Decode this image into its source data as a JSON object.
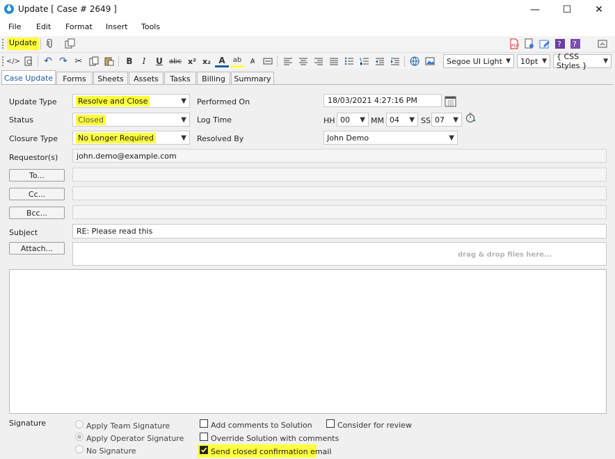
{
  "window": {
    "title": "Update [ Case # 2649 ]",
    "minimize": "—",
    "maximize": "☐",
    "close": "✕"
  },
  "menu": [
    "File",
    "Edit",
    "Format",
    "Insert",
    "Tools"
  ],
  "toolbar": {
    "update_label": "Update"
  },
  "editor": {
    "font": "Segoe UI Light",
    "size": "10pt",
    "styles": "{ CSS Styles }"
  },
  "tabs": [
    "Case Update",
    "Forms",
    "Sheets",
    "Assets",
    "Tasks",
    "Billing",
    "Summary"
  ],
  "form": {
    "update_type_label": "Update Type",
    "update_type_value": "Resolve and Close",
    "status_label": "Status",
    "status_value": "Closed",
    "closure_type_label": "Closure Type",
    "closure_type_value": "No Longer Required",
    "performed_on_label": "Performed On",
    "performed_on_value": "18/03/2021 4:27:16 PM",
    "log_time_label": "Log Time",
    "hh_label": "HH",
    "hh_value": "00",
    "mm_label": "MM",
    "mm_value": "04",
    "ss_label": "SS",
    "ss_value": "07",
    "resolved_by_label": "Resolved By",
    "resolved_by_value": "John Demo",
    "requestors_label": "Requestor(s)",
    "requestors_value": "john.demo@example.com",
    "to_button": "To...",
    "cc_button": "Cc...",
    "bcc_button": "Bcc...",
    "subject_label": "Subject",
    "subject_value": "RE: Please read this",
    "attach_button": "Attach...",
    "drop_hint": "drag & drop files here..."
  },
  "signature": {
    "label": "Signature",
    "options": [
      "Apply Team Signature",
      "Apply Operator Signature",
      "No Signature"
    ],
    "selected": "Apply Operator Signature"
  },
  "checkboxes": {
    "add_comments": "Add comments to Solution",
    "override_solution": "Override Solution with comments",
    "send_closed": "Send closed confirmation email",
    "consider_review": "Consider for review"
  },
  "colors": {
    "highlight": "#ffff3c",
    "active_tab": "#1e5aa8"
  }
}
